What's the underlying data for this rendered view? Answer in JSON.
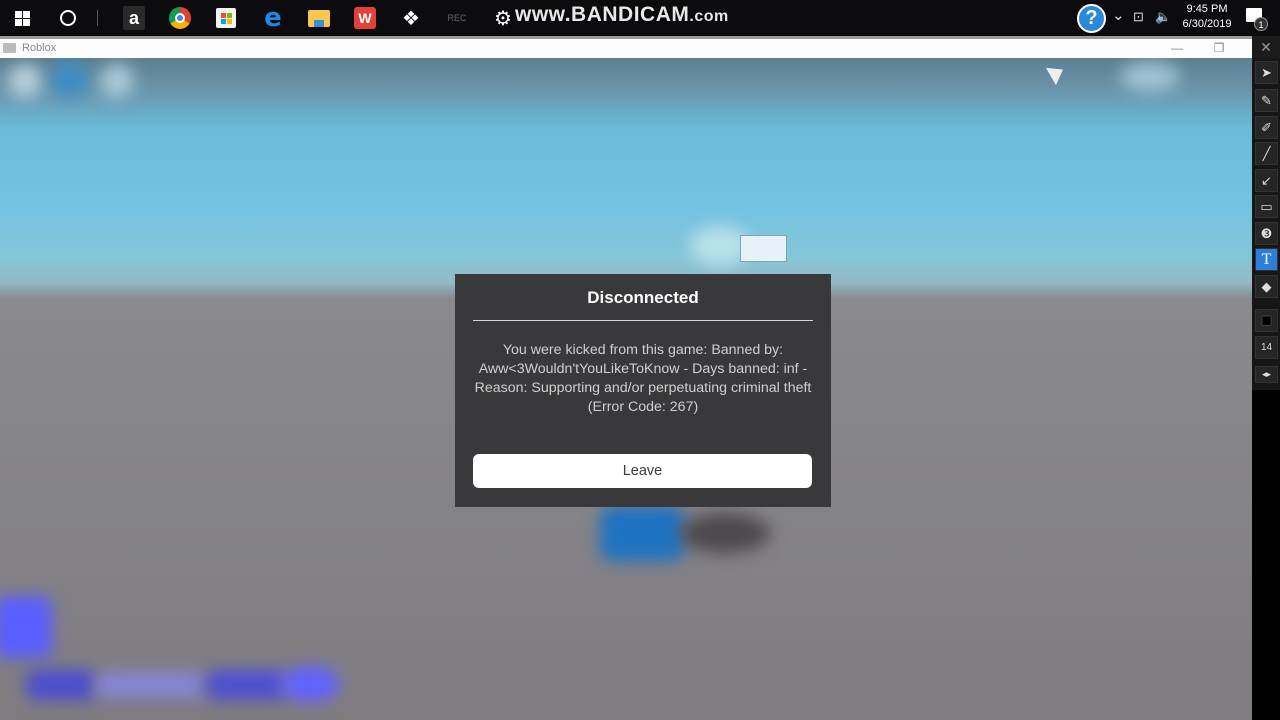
{
  "taskbar": {
    "apps": [
      {
        "name": "start",
        "icon": "windows-logo-icon"
      },
      {
        "name": "cortana",
        "icon": "cortana-circle-icon"
      },
      {
        "name": "amazon",
        "icon": "amazon-icon",
        "glyph": "a"
      },
      {
        "name": "chrome",
        "icon": "chrome-icon"
      },
      {
        "name": "microsoft-store",
        "icon": "store-icon"
      },
      {
        "name": "edge",
        "icon": "edge-icon",
        "glyph": "e"
      },
      {
        "name": "file-explorer",
        "icon": "folder-icon"
      },
      {
        "name": "wps-office",
        "icon": "wps-icon",
        "glyph": "W"
      },
      {
        "name": "dropbox",
        "icon": "dropbox-icon",
        "glyph": "❖"
      },
      {
        "name": "bandicam-app",
        "icon": "bandicam-icon",
        "glyph": "REC"
      },
      {
        "name": "settings",
        "icon": "gear-icon",
        "glyph": "⚙"
      }
    ],
    "watermark": {
      "main": "www.BANDICAM",
      "suffix": ".com"
    },
    "tray": {
      "help_glyph": "?",
      "chevron_glyph": "⌄",
      "network_glyph": "⊡",
      "volume_glyph": "🔈",
      "time": "9:45 PM",
      "date": "6/30/2019",
      "notification_count": "1"
    }
  },
  "window": {
    "title": "Roblox",
    "minimize_glyph": "—",
    "restore_glyph": "❐",
    "close_glyph": "✕"
  },
  "drawing_toolbar": {
    "tools": [
      {
        "name": "cursor",
        "glyph": "➤",
        "active": false
      },
      {
        "name": "pen",
        "glyph": "✎",
        "active": false
      },
      {
        "name": "highlighter",
        "glyph": "✐",
        "active": false
      },
      {
        "name": "line",
        "glyph": "╱",
        "active": false
      },
      {
        "name": "arrow",
        "glyph": "↙",
        "active": false
      },
      {
        "name": "rectangle",
        "glyph": "▭",
        "active": false
      },
      {
        "name": "numbering",
        "glyph": "❸",
        "active": false
      },
      {
        "name": "text",
        "glyph": "T",
        "active": true
      },
      {
        "name": "eraser",
        "glyph": "◆",
        "active": false
      }
    ],
    "color_glyph": "■",
    "font_size": "14",
    "collapse_glyph": "◂▸"
  },
  "dialog": {
    "title": "Disconnected",
    "message": "You were kicked from this game: Banned by: Aww<3Wouldn'tYouLikeToKnow - Days banned: inf - Reason: Supporting and/or perpetuating criminal theft",
    "error_code": "(Error Code: 267)",
    "leave_label": "Leave"
  },
  "colors": {
    "dialog_bg": "#39393b",
    "button_bg": "#ffffff",
    "sky": "#74c3e3",
    "ground": "#7f7c80",
    "active_tool": "#2b7fd6"
  }
}
